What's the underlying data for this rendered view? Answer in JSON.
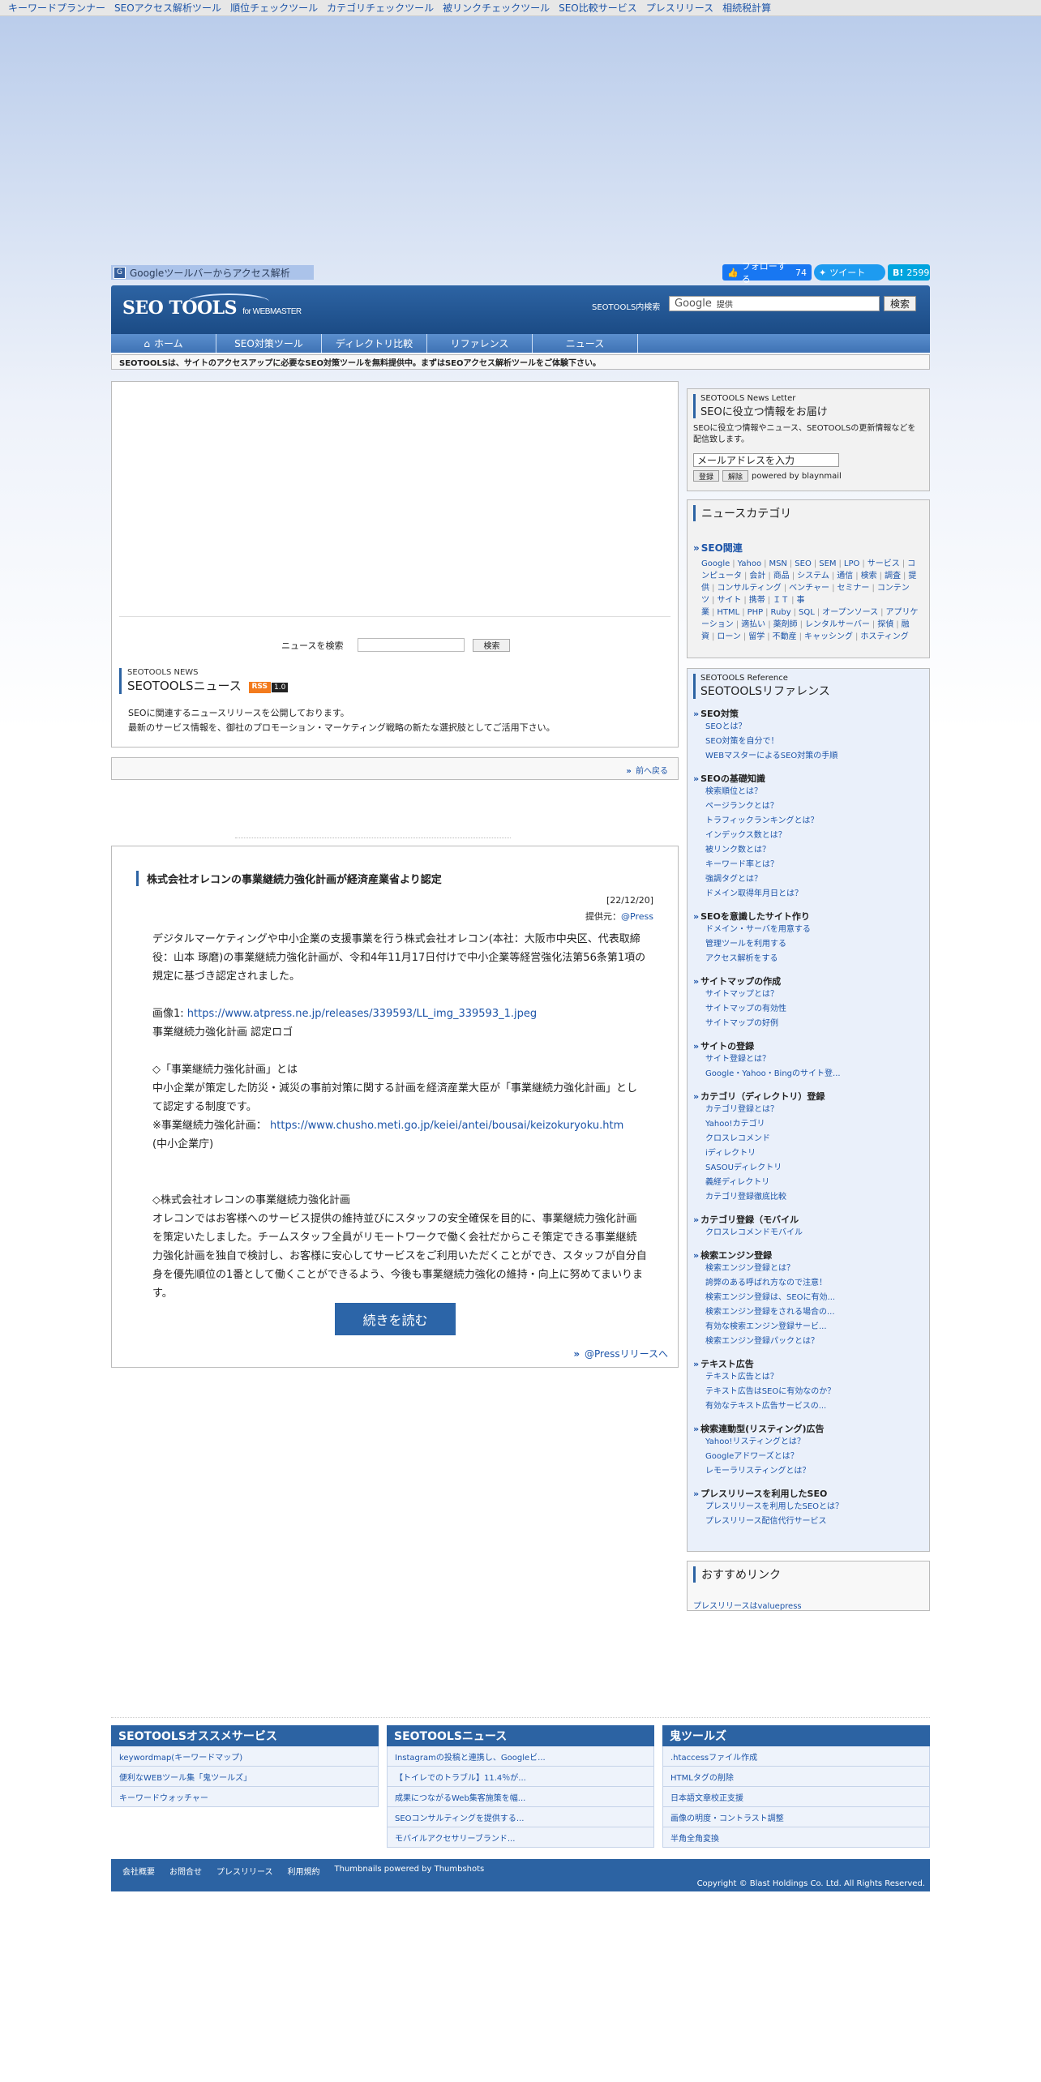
{
  "topnav": [
    "キーワードプランナー",
    "SEOアクセス解析ツール",
    "順位チェックツール",
    "カテゴリチェックツール",
    "被リンクチェックツール",
    "SEO比較サービス",
    "プレスリリース",
    "相続税計算"
  ],
  "subbar": {
    "toolbar_link": "Googleツールバーからアクセス解析",
    "fb_label": "フォローする",
    "fb_count": "74",
    "tw_label": "ツイート",
    "hb_count": "2599"
  },
  "header": {
    "logo_main": "SEO TOOLS",
    "logo_sub": "for WEBMASTER",
    "search_label": "SEOTOOLS内検索",
    "search_brand": "Google",
    "search_value": "提供",
    "search_button": "検索"
  },
  "nav": [
    {
      "label": "ホーム",
      "icon": "home-icon"
    },
    {
      "label": "SEO対策ツール"
    },
    {
      "label": "ディレクトリ比較"
    },
    {
      "label": "リファレンス"
    },
    {
      "label": "ニュース"
    }
  ],
  "notice": "SEOTOOLSは、サイトのアクセスアップに必要なSEO対策ツールを無料提供中。まずはSEOアクセス解析ツールをご体験下さい。",
  "main": {
    "news_search_label": "ニュースを検索",
    "news_search_button": "検索",
    "section_small": "SEOTOOLS NEWS",
    "section_title": "SEOTOOLSニュース",
    "rss_label": "RSS",
    "rss_version": "1.0",
    "desc1": "SEOに関連するニュースリリースを公開しております。",
    "desc2": "最新のサービス情報を、御社のプロモーション・マーケティング戦略の新たな選択肢としてご活用下さい。",
    "back_link": "前へ戻る"
  },
  "article": {
    "title": "株式会社オレコンの事業継続力強化計画が経済産業省より認定",
    "date": "[22/12/20]",
    "source_prefix": "提供元：",
    "source_link": "@Press",
    "p1": "デジタルマーケティングや中小企業の支援事業を行う株式会社オレコン(本社：大阪市中央区、代表取締役：山本 琢磨)の事業継続力強化計画が、令和4年11月17日付けで中小企業等経営強化法第56条第1項の規定に基づき認定されました。",
    "img_label": "画像1: ",
    "img_link": "https://www.atpress.ne.jp/releases/339593/LL_img_339593_1.jpeg",
    "img_caption": "事業継続力強化計画 認定ロゴ",
    "h1": "◇「事業継続力強化計画」とは",
    "p2": "中小企業が策定した防災・減災の事前対策に関する計画を経済産業大臣が「事業継続力強化計画」として認定する制度です。",
    "ref_label": "※事業継続力強化計画： ",
    "ref_link": "https://www.chusho.meti.go.jp/keiei/antei/bousai/keizokuryoku.htm",
    "ref_org": "(中小企業庁)",
    "h2": "◇株式会社オレコンの事業継続力強化計画",
    "p3": "オレコンではお客様へのサービス提供の維持並びにスタッフの安全確保を目的に、事業継続力強化計画を策定いたしました。チームスタッフ全員がリモートワークで働く会社だからこそ策定できる事業継続力強化計画を独自で検討し、お客様に安心してサービスをご利用いただくことができ、スタッフが自分自身を優先順位の1番として働くことができるよう、今後も事業継続力強化の維持・向上に努めてまいります。",
    "read_more": "続きを読む",
    "footer_link": "@Pressリリースへ"
  },
  "newsletter": {
    "small": "SEOTOOLS News Letter",
    "title": "SEOに役立つ情報をお届け",
    "desc": "SEOに役立つ情報やニュース、SEOTOOLSの更新情報などを配信致します。",
    "email_placeholder": "メールアドレスを入力",
    "subscribe": "登録",
    "unsubscribe": "解除",
    "powered": "powered by blaynmail"
  },
  "categories": {
    "title": "ニュースカテゴリ",
    "sub": "SEO関連",
    "tags": [
      "Google",
      "Yahoo",
      "MSN",
      "SEO",
      "SEM",
      "LPO",
      "サービス",
      "コンピュータ",
      "会計",
      "商品",
      "システム",
      "通信",
      "検索",
      "調査",
      "提供",
      "コンサルティング",
      "ベンチャー",
      "セミナー",
      "コンテンツ",
      "サイト",
      "携帯",
      "ＩＴ",
      "事業",
      "HTML",
      "PHP",
      "Ruby",
      "SQL",
      "オープンソース",
      "アプリケーション",
      "適払い",
      "薬剤師",
      "レンタルサーバー",
      "探偵",
      "融資",
      "ローン",
      "留学",
      "不動産",
      "キャッシング",
      "ホスティング"
    ]
  },
  "reference": {
    "small": "SEOTOOLS Reference",
    "title": "SEOTOOLSリファレンス",
    "groups": [
      {
        "title": "SEO対策",
        "items": [
          "SEOとは？",
          "SEO対策を自分で！",
          "WEBマスターによるSEO対策の手順"
        ]
      },
      {
        "title": "SEOの基礎知識",
        "items": [
          "検索順位とは？",
          "ページランクとは？",
          "トラフィックランキングとは？",
          "インデックス数とは？",
          "被リンク数とは？",
          "キーワード率とは？",
          "強調タグとは？",
          "ドメイン取得年月日とは？"
        ]
      },
      {
        "title": "SEOを意識したサイト作り",
        "items": [
          "ドメイン・サーバを用意する",
          "管理ツールを利用する",
          "アクセス解析をする"
        ]
      },
      {
        "title": "サイトマップの作成",
        "items": [
          "サイトマップとは？",
          "サイトマップの有効性",
          "サイトマップの好例"
        ]
      },
      {
        "title": "サイトの登録",
        "items": [
          "サイト登録とは？",
          "Google・Yahoo・Bingのサイト登..."
        ]
      },
      {
        "title": "カテゴリ（ディレクトリ）登録",
        "items": [
          "カテゴリ登録とは？",
          "Yahoo!カテゴリ",
          "クロスレコメンド",
          "iディレクトリ",
          "SASOUディレクトリ",
          "義経ディレクトリ",
          "カテゴリ登録徹底比較"
        ]
      },
      {
        "title": "カテゴリ登録（モバイル",
        "items": [
          "クロスレコメンドモバイル"
        ]
      },
      {
        "title": "検索エンジン登録",
        "items": [
          "検索エンジン登録とは？",
          "誇弊のある呼ばれ方なので注意！",
          "検索エンジン登録は、SEOに有効...",
          "検索エンジン登録をされる場合の...",
          "有効な検索エンジン登録サービ...",
          "検索エンジン登録パックとは？"
        ]
      },
      {
        "title": "テキスト広告",
        "items": [
          "テキスト広告とは？",
          "テキスト広告はSEOに有効なのか？",
          "有効なテキスト広告サービスの..."
        ]
      },
      {
        "title": "検索連動型(リスティング)広告",
        "items": [
          "Yahoo!リスティングとは？",
          "Googleアドワーズとは？",
          "レモーラリスティングとは？"
        ]
      },
      {
        "title": "プレスリリースを利用したSEO",
        "items": [
          "プレスリリースを利用したSEOとは？",
          "プレスリリース配信代行サービス"
        ]
      }
    ]
  },
  "recommend": {
    "title": "おすすめリンク",
    "link": "プレスリリースはvaluepress"
  },
  "footer": {
    "columns": [
      {
        "title": "SEOTOOLSオススメサービス",
        "items": [
          "keywordmap(キーワードマップ)",
          "便利なWEBツール集「鬼ツールズ」",
          "キーワードウォッチャー"
        ]
      },
      {
        "title": "SEOTOOLSニュース",
        "items": [
          "Instagramの投稿と連携し、Googleビ...",
          "【トイレでのトラブル】11.4％が...",
          "成果につながるWeb集客施策を幅...",
          "SEOコンサルティングを提供する...",
          "モバイルアクセサリーブランド..."
        ]
      },
      {
        "title": "鬼ツールズ",
        "items": [
          ".htaccessファイル作成",
          "HTMLタグの削除",
          "日本語文章校正支援",
          "画像の明度・コントラスト調整",
          "半角全角変換"
        ]
      }
    ],
    "links": [
      "会社概要",
      "お問合せ",
      "プレスリリース",
      "利用規約",
      "Thumbnails powered by Thumbshots"
    ],
    "copyright": "Copyright © Blast Holdings Co. Ltd. All Rights Reserved."
  }
}
